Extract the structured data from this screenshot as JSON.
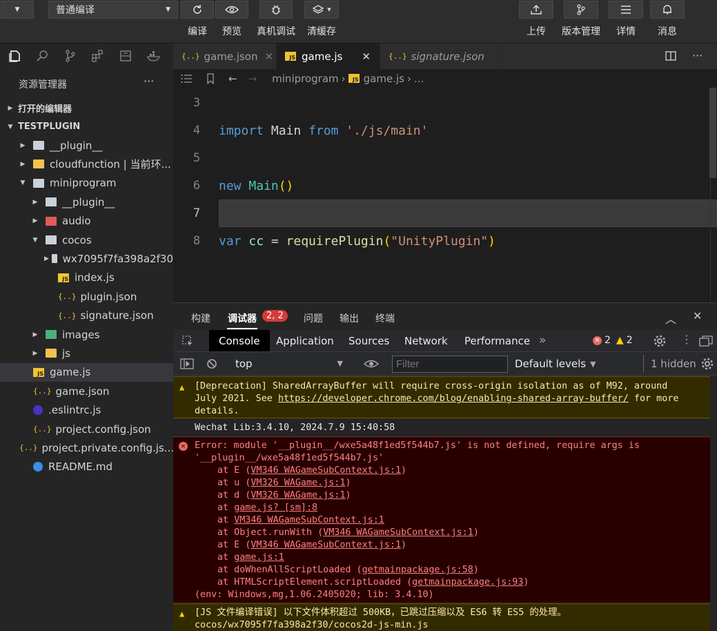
{
  "toolbar": {
    "mode_select": "普通编译",
    "left_labels": [
      "编译",
      "预览",
      "真机调试",
      "清缓存"
    ],
    "right_labels": [
      "上传",
      "版本管理",
      "详情",
      "消息"
    ]
  },
  "explorer": {
    "title": "资源管理器",
    "more": "···",
    "open_editors": "打开的编辑器",
    "project": "TESTPLUGIN",
    "items": [
      {
        "label": "__plugin__",
        "type": "folder"
      },
      {
        "label": "cloudfunction | 当前环...",
        "type": "folder"
      },
      {
        "label": "miniprogram",
        "type": "folder"
      },
      {
        "label": "__plugin__",
        "type": "folder"
      },
      {
        "label": "audio",
        "type": "folder"
      },
      {
        "label": "cocos",
        "type": "folder"
      },
      {
        "label": "wx7095f7fa398a2f30",
        "type": "folder"
      },
      {
        "label": "index.js",
        "type": "js"
      },
      {
        "label": "plugin.json",
        "type": "json"
      },
      {
        "label": "signature.json",
        "type": "json"
      },
      {
        "label": "images",
        "type": "folder"
      },
      {
        "label": "js",
        "type": "folder"
      },
      {
        "label": "game.js",
        "type": "js"
      },
      {
        "label": "game.json",
        "type": "json"
      },
      {
        "label": ".eslintrc.js",
        "type": "eslint"
      },
      {
        "label": "project.config.json",
        "type": "json"
      },
      {
        "label": "project.private.config.js...",
        "type": "json"
      },
      {
        "label": "README.md",
        "type": "info"
      }
    ]
  },
  "tabs": [
    "game.json",
    "game.js",
    "signature.json"
  ],
  "breadcrumb": {
    "folder": "miniprogram",
    "file": "game.js",
    "rest": "..."
  },
  "editor": {
    "line_numbers": [
      "3",
      "4",
      "5",
      "6",
      "7",
      "8"
    ],
    "code": {
      "l4_kw1": "import",
      "l4_name": " Main ",
      "l4_kw2": "from",
      "l4_str": " './js/main'",
      "l6_kw": "new",
      "l6_fn": " Main",
      "l6_paren": "()",
      "l8_kw": "var",
      "l8_var": " cc",
      "l8_eq": " = ",
      "l8_fn": "requirePlugin",
      "l8_p1": "(",
      "l8_str": "\"UnityPlugin\"",
      "l8_p2": ")"
    }
  },
  "panel": {
    "tabs": [
      "构建",
      "调试器",
      "问题",
      "输出",
      "终端"
    ],
    "badge": "2, 2"
  },
  "devtools": {
    "tabs": [
      "Console",
      "Application",
      "Sources",
      "Network",
      "Performance"
    ],
    "more": "»",
    "error_count": "2",
    "warn_count": "2",
    "context": "top",
    "filter_placeholder": "Filter",
    "levels": "Default levels",
    "hidden": "1 hidden"
  },
  "console": {
    "m1_a": "[Deprecation] SharedArrayBuffer will require cross-origin isolation as of M92, around",
    "m1_b": "July 2021. See ",
    "m1_link": "https://developer.chrome.com/blog/enabling-shared-array-buffer/",
    "m1_c": " for more",
    "m1_d": "details.",
    "m2": "Wechat Lib:3.4.10, 2024.7.9 15:40:58",
    "m3_a": "Error: module '__plugin__/wxe5a48f1ed5f544b7.js' is not defined, require args is",
    "m3_b": "'__plugin__/wxe5a48f1ed5f544b7.js'",
    "stack": [
      {
        "pre": "at E (",
        "link": "VM346 WAGameSubContext.js:1",
        "post": ")"
      },
      {
        "pre": "at u (",
        "link": "VM326 WAGame.js:1",
        "post": ")"
      },
      {
        "pre": "at d (",
        "link": "VM326 WAGame.js:1",
        "post": ")"
      },
      {
        "pre": "at ",
        "link": "game.js? [sm]:8",
        "post": ""
      },
      {
        "pre": "at ",
        "link": "VM346 WAGameSubContext.js:1",
        "post": ""
      },
      {
        "pre": "at Object.runWith (",
        "link": "VM346 WAGameSubContext.js:1",
        "post": ")"
      },
      {
        "pre": "at E (",
        "link": "VM346 WAGameSubContext.js:1",
        "post": ")"
      },
      {
        "pre": "at ",
        "link": "game.js:1",
        "post": ""
      },
      {
        "pre": "at doWhenAllScriptLoaded (",
        "link": "getmainpackage.js:58",
        "post": ")"
      },
      {
        "pre": "at HTMLScriptElement.scriptLoaded (",
        "link": "getmainpackage.js:93",
        "post": ")"
      }
    ],
    "m3_env": "(env: Windows,mg,1.06.2405020; lib: 3.4.10)",
    "m4_a": "[JS 文件编译错误] 以下文件体积超过 500KB，已跳过压缩以及 ES6 转 ES5 的处理。",
    "m4_b": "cocos/wx7095f7fa398a2f30/cocos2d-js-min.js"
  }
}
